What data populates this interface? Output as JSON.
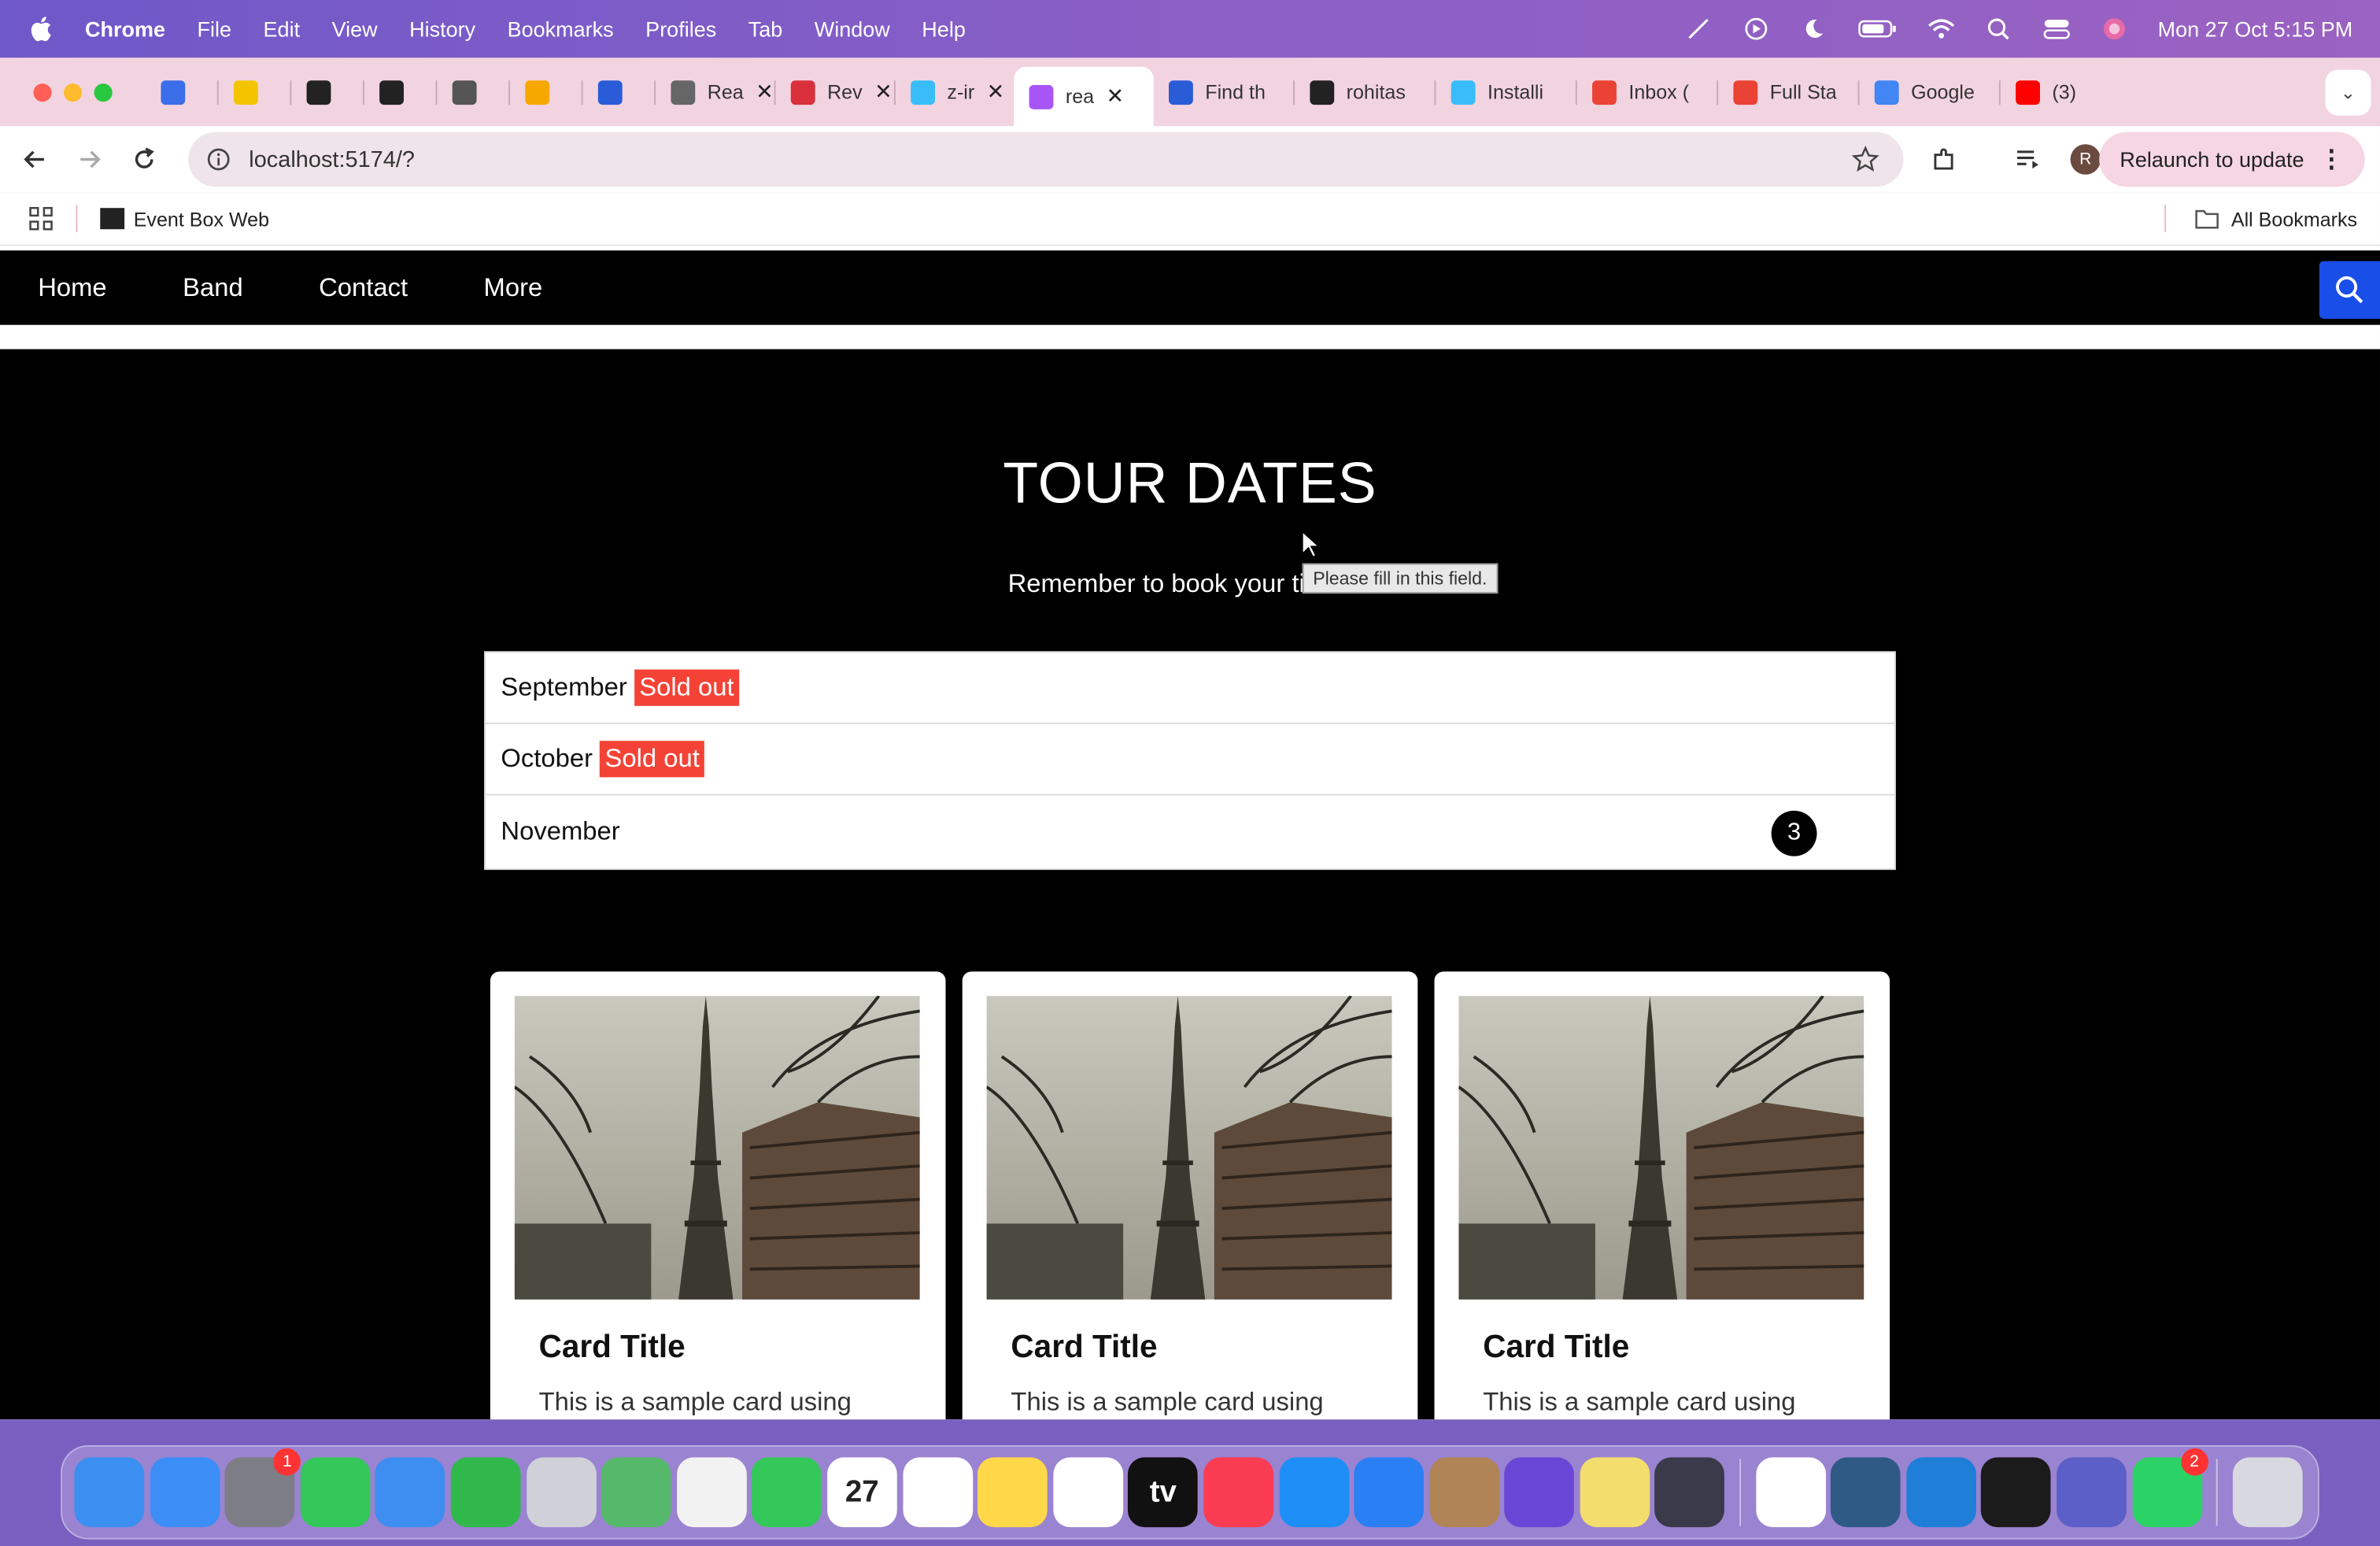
{
  "menubar": {
    "app": "Chrome",
    "items": [
      "File",
      "Edit",
      "View",
      "History",
      "Bookmarks",
      "Profiles",
      "Tab",
      "Window",
      "Help"
    ],
    "clock": "Mon 27 Oct  5:15 PM"
  },
  "tabs": [
    {
      "label": "",
      "color": "#3b6ee8"
    },
    {
      "label": "",
      "color": "#f5c400"
    },
    {
      "label": "",
      "color": "#222222"
    },
    {
      "label": "",
      "color": "#222222"
    },
    {
      "label": "",
      "color": "#555555"
    },
    {
      "label": "",
      "color": "#f6a800"
    },
    {
      "label": "",
      "color": "#2b5cd8"
    },
    {
      "label": "Rea",
      "color": "#666666"
    },
    {
      "label": "Rev",
      "color": "#d9303c"
    },
    {
      "label": "z-ir",
      "color": "#38bdf8"
    },
    {
      "label": "rea",
      "color": "#a855f7",
      "active": true
    },
    {
      "label": "Find th",
      "color": "#2b5cd8"
    },
    {
      "label": "rohitas",
      "color": "#222222"
    },
    {
      "label": "Installi",
      "color": "#38bdf8"
    },
    {
      "label": "Inbox (",
      "color": "#ea4335"
    },
    {
      "label": "Full Sta",
      "color": "#ea4335"
    },
    {
      "label": "Google",
      "color": "#4285f4"
    },
    {
      "label": "(3)",
      "color": "#ff0000"
    }
  ],
  "toolbar": {
    "url": "localhost:5174/?",
    "relaunch_label": "Relaunch to update",
    "profile_initial": "R"
  },
  "bookmarks": {
    "item": "Event Box Web",
    "all": "All Bookmarks"
  },
  "nav": {
    "links": [
      "Home",
      "Band",
      "Contact",
      "More"
    ]
  },
  "tour": {
    "title": "TOUR DATES",
    "subtitle": "Remember to book your ti",
    "tooltip": "Please fill in this field.",
    "months": [
      {
        "name": "September",
        "badge": "Sold out"
      },
      {
        "name": "October",
        "badge": "Sold out"
      },
      {
        "name": "November",
        "count": "3"
      }
    ]
  },
  "cards": [
    {
      "title": "Card Title",
      "text": "This is a sample card using"
    },
    {
      "title": "Card Title",
      "text": "This is a sample card using"
    },
    {
      "title": "Card Title",
      "text": "This is a sample card using"
    }
  ],
  "dock": {
    "apps": [
      {
        "name": "finder",
        "color": "#3b8ff0"
      },
      {
        "name": "safari",
        "color": "#3c8df5"
      },
      {
        "name": "system-settings",
        "color": "#7d7d85",
        "badge": "1"
      },
      {
        "name": "messages",
        "color": "#34c759"
      },
      {
        "name": "mail",
        "color": "#3d8ef0"
      },
      {
        "name": "numbers",
        "color": "#30b94a"
      },
      {
        "name": "launchpad",
        "color": "#d0d0d8"
      },
      {
        "name": "maps",
        "color": "#55b86a"
      },
      {
        "name": "photos",
        "color": "#f2f2f2"
      },
      {
        "name": "facetime",
        "color": "#34c759"
      },
      {
        "name": "calendar",
        "color": "#ffffff",
        "text": "27"
      },
      {
        "name": "reminders",
        "color": "#ffffff"
      },
      {
        "name": "notes",
        "color": "#ffd84a"
      },
      {
        "name": "freeform",
        "color": "#ffffff"
      },
      {
        "name": "apple-tv",
        "color": "#111111",
        "text": "tv"
      },
      {
        "name": "music",
        "color": "#fa3c52"
      },
      {
        "name": "app-store",
        "color": "#1e8ef7"
      },
      {
        "name": "keynote",
        "color": "#2b7ff5"
      },
      {
        "name": "contacts",
        "color": "#b08457"
      },
      {
        "name": "imovie",
        "color": "#6a47d6"
      },
      {
        "name": "stickies",
        "color": "#f3dd6d"
      },
      {
        "name": "quicktime",
        "color": "#3a3a4a"
      },
      {
        "name": "chrome",
        "color": "#ffffff",
        "sep": true
      },
      {
        "name": "mysql-workbench",
        "color": "#2f5a86"
      },
      {
        "name": "vscode",
        "color": "#1f7ed8"
      },
      {
        "name": "terminal",
        "color": "#1b1b1b"
      },
      {
        "name": "teams",
        "color": "#5b5fc7"
      },
      {
        "name": "whatsapp",
        "color": "#2bd366",
        "badge": "2"
      },
      {
        "name": "trash",
        "color": "#d8d8e0",
        "sep": true
      }
    ]
  }
}
